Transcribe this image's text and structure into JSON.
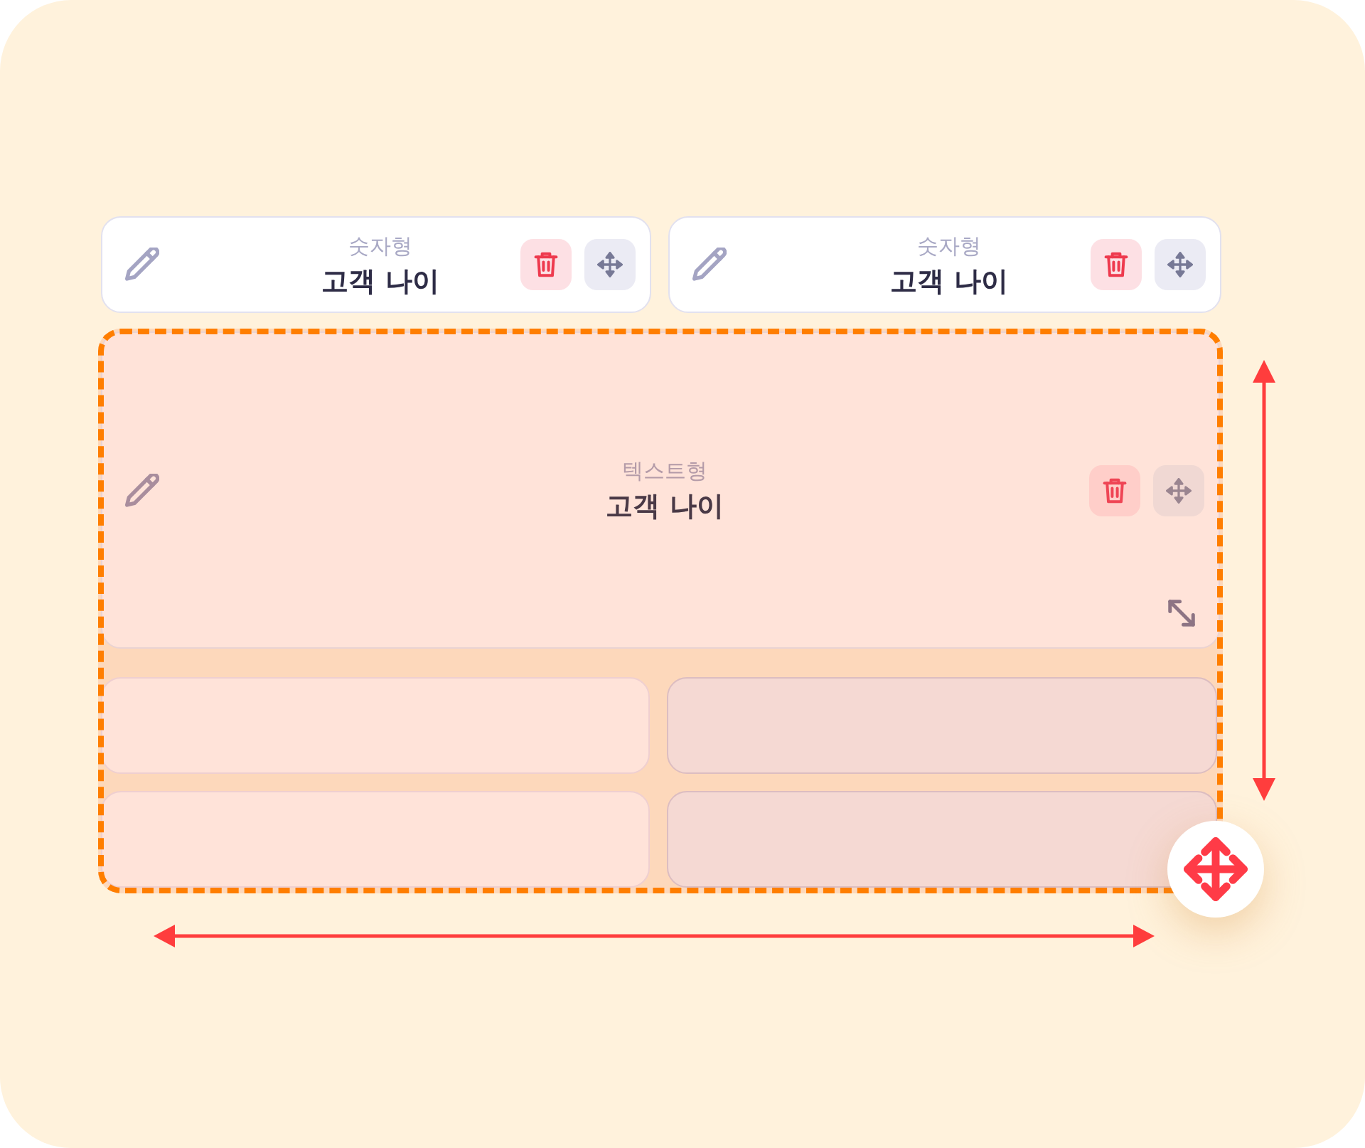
{
  "widgets": [
    {
      "type_label": "숫자형",
      "title": "고객 나이",
      "resizable": false
    },
    {
      "type_label": "숫자형",
      "title": "고객 나이",
      "resizable": false
    }
  ],
  "selection": {
    "widget": {
      "type_label": "텍스트형",
      "title": "고객 나이",
      "resizable": true
    },
    "slots": [
      {
        "dimmed": false
      },
      {
        "dimmed": true
      },
      {
        "dimmed": false
      },
      {
        "dimmed": true
      }
    ]
  }
}
